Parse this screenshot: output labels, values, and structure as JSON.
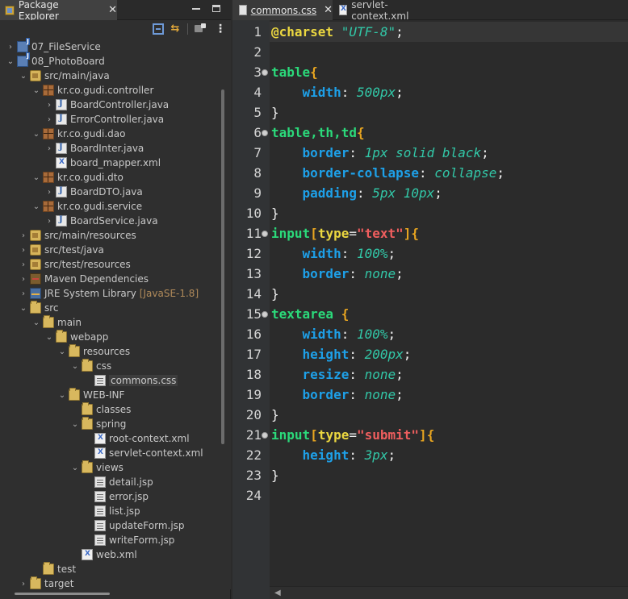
{
  "explorer": {
    "title": "Package Explorer",
    "close_glyph": "✕",
    "tree": [
      {
        "label": "07_FileService",
        "icon": "project-icon",
        "depth": 0,
        "twisty": "›"
      },
      {
        "label": "08_PhotoBoard",
        "icon": "project-icon",
        "depth": 0,
        "twisty": "⌄"
      },
      {
        "label": "src/main/java",
        "icon": "source-folder-icon",
        "depth": 1,
        "twisty": "⌄"
      },
      {
        "label": "kr.co.gudi.controller",
        "icon": "package-icon",
        "depth": 2,
        "twisty": "⌄"
      },
      {
        "label": "BoardController.java",
        "icon": "java-file-icon",
        "depth": 3,
        "twisty": "›"
      },
      {
        "label": "ErrorController.java",
        "icon": "java-file-icon",
        "depth": 3,
        "twisty": "›"
      },
      {
        "label": "kr.co.gudi.dao",
        "icon": "package-icon",
        "depth": 2,
        "twisty": "⌄"
      },
      {
        "label": "BoardInter.java",
        "icon": "java-interface-icon",
        "depth": 3,
        "twisty": "›"
      },
      {
        "label": "board_mapper.xml",
        "icon": "xml-file-icon",
        "depth": 3,
        "twisty": ""
      },
      {
        "label": "kr.co.gudi.dto",
        "icon": "package-icon",
        "depth": 2,
        "twisty": "⌄"
      },
      {
        "label": "BoardDTO.java",
        "icon": "java-file-icon",
        "depth": 3,
        "twisty": "›"
      },
      {
        "label": "kr.co.gudi.service",
        "icon": "package-icon",
        "depth": 2,
        "twisty": "⌄"
      },
      {
        "label": "BoardService.java",
        "icon": "java-file-icon",
        "depth": 3,
        "twisty": "›"
      },
      {
        "label": "src/main/resources",
        "icon": "source-folder-icon",
        "depth": 1,
        "twisty": "›"
      },
      {
        "label": "src/test/java",
        "icon": "source-folder-icon",
        "depth": 1,
        "twisty": "›"
      },
      {
        "label": "src/test/resources",
        "icon": "source-folder-icon",
        "depth": 1,
        "twisty": "›"
      },
      {
        "label": "Maven Dependencies",
        "icon": "maven-library-icon",
        "depth": 1,
        "twisty": "›"
      },
      {
        "label": "JRE System Library",
        "suffix": "[JavaSE-1.8]",
        "icon": "jre-library-icon",
        "depth": 1,
        "twisty": "›"
      },
      {
        "label": "src",
        "icon": "folder-icon",
        "depth": 1,
        "twisty": "⌄"
      },
      {
        "label": "main",
        "icon": "folder-icon",
        "depth": 2,
        "twisty": "⌄"
      },
      {
        "label": "webapp",
        "icon": "folder-icon",
        "depth": 3,
        "twisty": "⌄"
      },
      {
        "label": "resources",
        "icon": "folder-icon",
        "depth": 4,
        "twisty": "⌄"
      },
      {
        "label": "css",
        "icon": "folder-icon",
        "depth": 5,
        "twisty": "⌄"
      },
      {
        "label": "commons.css",
        "icon": "css-file-icon",
        "depth": 6,
        "twisty": "",
        "selected": true
      },
      {
        "label": "WEB-INF",
        "icon": "folder-icon",
        "depth": 4,
        "twisty": "⌄"
      },
      {
        "label": "classes",
        "icon": "folder-icon",
        "depth": 5,
        "twisty": ""
      },
      {
        "label": "spring",
        "icon": "folder-icon",
        "depth": 5,
        "twisty": "⌄"
      },
      {
        "label": "root-context.xml",
        "icon": "xml-file-icon",
        "depth": 6,
        "twisty": ""
      },
      {
        "label": "servlet-context.xml",
        "icon": "xml-file-icon",
        "depth": 6,
        "twisty": ""
      },
      {
        "label": "views",
        "icon": "folder-icon",
        "depth": 5,
        "twisty": "⌄"
      },
      {
        "label": "detail.jsp",
        "icon": "jsp-file-icon",
        "depth": 6,
        "twisty": ""
      },
      {
        "label": "error.jsp",
        "icon": "jsp-file-icon",
        "depth": 6,
        "twisty": ""
      },
      {
        "label": "list.jsp",
        "icon": "jsp-file-icon",
        "depth": 6,
        "twisty": ""
      },
      {
        "label": "updateForm.jsp",
        "icon": "jsp-file-icon",
        "depth": 6,
        "twisty": ""
      },
      {
        "label": "writeForm.jsp",
        "icon": "jsp-file-icon",
        "depth": 6,
        "twisty": ""
      },
      {
        "label": "web.xml",
        "icon": "xml-file-icon",
        "depth": 5,
        "twisty": ""
      },
      {
        "label": "test",
        "icon": "folder-icon",
        "depth": 2,
        "twisty": ""
      },
      {
        "label": "target",
        "icon": "folder-icon",
        "depth": 1,
        "twisty": "›"
      }
    ]
  },
  "editor": {
    "tabs": [
      {
        "label": "commons.css",
        "icon": "css-file-icon",
        "close_glyph": "✕",
        "active": true
      },
      {
        "label": "servlet-context.xml",
        "icon": "xml-file-icon",
        "active": false
      }
    ],
    "lines": [
      {
        "n": "1",
        "fold": false,
        "tokens": [
          [
            "at",
            "@charset"
          ],
          [
            "b",
            " "
          ],
          [
            "str-it",
            "\"UTF-8\""
          ],
          [
            "b",
            ";"
          ]
        ]
      },
      {
        "n": "2",
        "fold": false,
        "tokens": []
      },
      {
        "n": "3",
        "fold": true,
        "tokens": [
          [
            "k",
            "table"
          ],
          [
            "br",
            "{"
          ]
        ]
      },
      {
        "n": "4",
        "fold": false,
        "tokens": [
          [
            "b",
            "    "
          ],
          [
            "p",
            "width"
          ],
          [
            "b",
            ": "
          ],
          [
            "v",
            "500px"
          ],
          [
            "b",
            ";"
          ]
        ]
      },
      {
        "n": "5",
        "fold": false,
        "tokens": [
          [
            "b",
            "}"
          ]
        ]
      },
      {
        "n": "6",
        "fold": true,
        "tokens": [
          [
            "k",
            "table,th,td"
          ],
          [
            "br",
            "{"
          ]
        ]
      },
      {
        "n": "7",
        "fold": false,
        "tokens": [
          [
            "b",
            "    "
          ],
          [
            "p",
            "border"
          ],
          [
            "b",
            ": "
          ],
          [
            "v",
            "1px solid black"
          ],
          [
            "b",
            ";"
          ]
        ]
      },
      {
        "n": "8",
        "fold": false,
        "tokens": [
          [
            "b",
            "    "
          ],
          [
            "p",
            "border-collapse"
          ],
          [
            "b",
            ": "
          ],
          [
            "v",
            "collapse"
          ],
          [
            "b",
            ";"
          ]
        ]
      },
      {
        "n": "9",
        "fold": false,
        "tokens": [
          [
            "b",
            "    "
          ],
          [
            "p",
            "padding"
          ],
          [
            "b",
            ": "
          ],
          [
            "v",
            "5px 10px"
          ],
          [
            "b",
            ";"
          ]
        ]
      },
      {
        "n": "10",
        "fold": false,
        "tokens": [
          [
            "b",
            "}"
          ]
        ]
      },
      {
        "n": "11",
        "fold": true,
        "tokens": [
          [
            "k",
            "input"
          ],
          [
            "br",
            "["
          ],
          [
            "q",
            "type"
          ],
          [
            "b",
            "="
          ],
          [
            "s",
            "\"text\""
          ],
          [
            "br",
            "]"
          ],
          [
            "br",
            "{"
          ]
        ]
      },
      {
        "n": "12",
        "fold": false,
        "tokens": [
          [
            "b",
            "    "
          ],
          [
            "p",
            "width"
          ],
          [
            "b",
            ": "
          ],
          [
            "v",
            "100%"
          ],
          [
            "b",
            ";"
          ]
        ]
      },
      {
        "n": "13",
        "fold": false,
        "tokens": [
          [
            "b",
            "    "
          ],
          [
            "p",
            "border"
          ],
          [
            "b",
            ": "
          ],
          [
            "v",
            "none"
          ],
          [
            "b",
            ";"
          ]
        ]
      },
      {
        "n": "14",
        "fold": false,
        "tokens": [
          [
            "b",
            "}"
          ]
        ]
      },
      {
        "n": "15",
        "fold": true,
        "tokens": [
          [
            "k",
            "textarea"
          ],
          [
            "b",
            " "
          ],
          [
            "br",
            "{"
          ]
        ]
      },
      {
        "n": "16",
        "fold": false,
        "tokens": [
          [
            "b",
            "    "
          ],
          [
            "p",
            "width"
          ],
          [
            "b",
            ": "
          ],
          [
            "v",
            "100%"
          ],
          [
            "b",
            ";"
          ]
        ]
      },
      {
        "n": "17",
        "fold": false,
        "tokens": [
          [
            "b",
            "    "
          ],
          [
            "p",
            "height"
          ],
          [
            "b",
            ": "
          ],
          [
            "v",
            "200px"
          ],
          [
            "b",
            ";"
          ]
        ]
      },
      {
        "n": "18",
        "fold": false,
        "tokens": [
          [
            "b",
            "    "
          ],
          [
            "p",
            "resize"
          ],
          [
            "b",
            ": "
          ],
          [
            "v",
            "none"
          ],
          [
            "b",
            ";"
          ]
        ]
      },
      {
        "n": "19",
        "fold": false,
        "tokens": [
          [
            "b",
            "    "
          ],
          [
            "p",
            "border"
          ],
          [
            "b",
            ": "
          ],
          [
            "v",
            "none"
          ],
          [
            "b",
            ";"
          ]
        ]
      },
      {
        "n": "20",
        "fold": false,
        "tokens": [
          [
            "b",
            "}"
          ]
        ]
      },
      {
        "n": "21",
        "fold": true,
        "tokens": [
          [
            "k",
            "input"
          ],
          [
            "br",
            "["
          ],
          [
            "q",
            "type"
          ],
          [
            "b",
            "="
          ],
          [
            "s",
            "\"submit\""
          ],
          [
            "br",
            "]"
          ],
          [
            "br",
            "{"
          ]
        ]
      },
      {
        "n": "22",
        "fold": false,
        "tokens": [
          [
            "b",
            "    "
          ],
          [
            "p",
            "height"
          ],
          [
            "b",
            ": "
          ],
          [
            "v",
            "3px"
          ],
          [
            "b",
            ";"
          ]
        ]
      },
      {
        "n": "23",
        "fold": false,
        "tokens": [
          [
            "b",
            "}"
          ]
        ]
      },
      {
        "n": "24",
        "fold": false,
        "tokens": []
      }
    ]
  }
}
